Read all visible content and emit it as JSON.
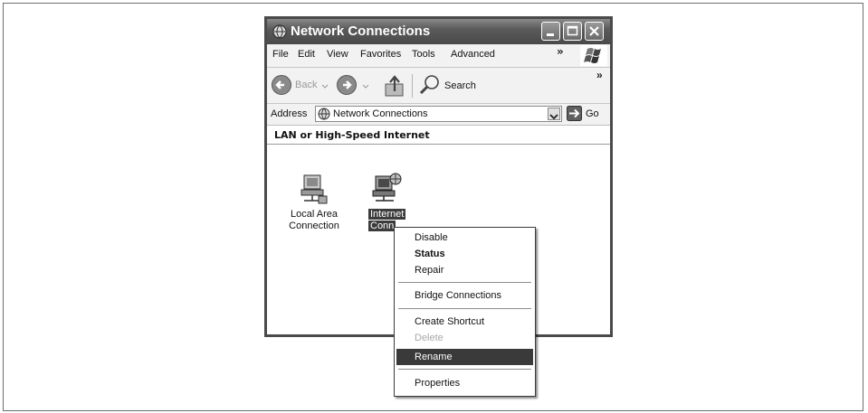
{
  "window": {
    "title": "Network Connections",
    "icon": "network-connections-icon",
    "controls": [
      "minimize-icon",
      "maximize-icon",
      "close-icon"
    ]
  },
  "menubar": {
    "items": [
      "File",
      "Edit",
      "View",
      "Favorites",
      "Tools",
      "Advanced"
    ],
    "more": "»"
  },
  "toolbar": {
    "back_label": "Back",
    "search_label": "Search",
    "more": "»"
  },
  "address": {
    "label": "Address",
    "value": "Network Connections",
    "go_label": "Go"
  },
  "content": {
    "group_header": "LAN or High-Speed Internet",
    "items": [
      {
        "line1": "Local Area",
        "line2": "Connection",
        "icon": "lan-connection-icon",
        "selected": false
      },
      {
        "line1": "Internet",
        "line2": "Conn",
        "icon": "internet-connection-icon",
        "selected": true
      }
    ]
  },
  "context_menu": {
    "items": [
      {
        "label": "Disable",
        "style": "normal"
      },
      {
        "label": "Status",
        "style": "bold"
      },
      {
        "label": "Repair",
        "style": "normal"
      },
      {
        "label": "Bridge Connections",
        "style": "normal"
      },
      {
        "label": "Create Shortcut",
        "style": "normal"
      },
      {
        "label": "Delete",
        "style": "disabled"
      },
      {
        "label": "Rename",
        "style": "highlighted"
      },
      {
        "label": "Properties",
        "style": "normal"
      }
    ]
  },
  "colors": {
    "titlebar": "#4a4a4a",
    "highlight": "#3a3a3a",
    "window_border": "#4a4a4a"
  }
}
